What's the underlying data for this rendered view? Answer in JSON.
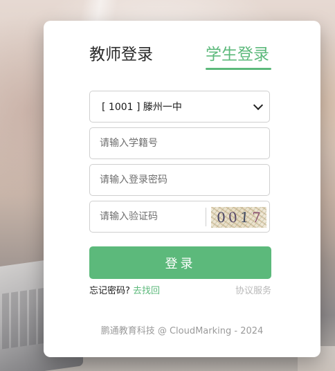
{
  "tabs": {
    "teacher_label": "教师登录",
    "student_label": "学生登录",
    "active": "student"
  },
  "form": {
    "school_select": {
      "selected_value": "[ 1001 ] 滕州一中"
    },
    "student_id": {
      "placeholder": "请输入学籍号",
      "value": ""
    },
    "password": {
      "placeholder": "请输入登录密码",
      "value": ""
    },
    "captcha": {
      "placeholder": "请输入验证码",
      "value": "",
      "image_digits": [
        "0",
        "0",
        "1",
        "7"
      ]
    },
    "submit_label": "登录"
  },
  "links": {
    "forgot_prefix": "忘记密码?",
    "forgot_link": "去找回",
    "agreement": "协议服务"
  },
  "footer": {
    "copyright": "鹏通教育科技 @ CloudMarking - 2024"
  },
  "colors": {
    "accent": "#5cb97b",
    "card_background": "#ffffff",
    "muted_text": "#9a9a9a"
  },
  "icons": {
    "select_arrow": "chevron-down-icon"
  }
}
